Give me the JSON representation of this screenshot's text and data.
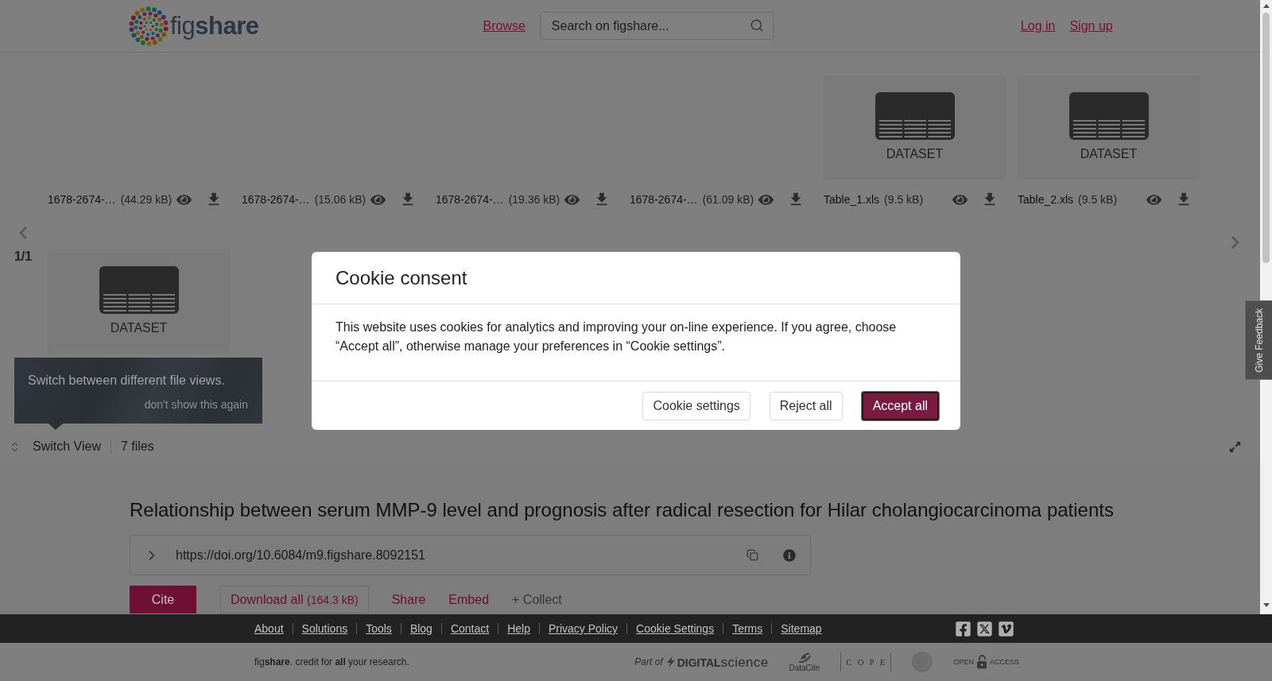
{
  "header": {
    "logo": "fig**share**",
    "nav_links": [
      {
        "label": "Browse"
      }
    ],
    "search": {
      "placeholder": "Search on figshare..."
    },
    "account_links": [
      {
        "label": "Log in"
      },
      {
        "label": "Sign up"
      }
    ]
  },
  "viewer": {
    "files": [
      {
        "name": "1678-2674-…",
        "size": "(44.29 kB)",
        "preview": {
          "kind": "blank"
        }
      },
      {
        "name": "1678-2674-…",
        "size": "(15.06 kB)",
        "preview": {
          "kind": "blank"
        }
      },
      {
        "name": "1678-2674-…",
        "size": "(19.36 kB)",
        "preview": {
          "kind": "blank"
        }
      },
      {
        "name": "1678-2674-…",
        "size": "(61.09 kB)",
        "preview": {
          "kind": "blank"
        }
      },
      {
        "name": "Table_1.xls",
        "size": "(9.5 kB)",
        "preview": {
          "kind": "dataset",
          "label": "DATASET"
        }
      },
      {
        "name": "Table_2.xls",
        "size": "(9.5 kB)",
        "preview": {
          "kind": "dataset",
          "label": "DATASET"
        }
      }
    ],
    "page_counter": "1/1",
    "next_row": [
      {
        "preview": {
          "kind": "dataset",
          "label": "DATASET"
        }
      }
    ],
    "tooltip": {
      "text": "Switch between different file views.",
      "dismiss": "don't show this again"
    },
    "toolbar": {
      "switch_view": "Switch View",
      "file_count": "7 files"
    }
  },
  "article": {
    "title": "Relationship between serum MMP-9 level and prognosis after radical resection for Hilar cholangiocarcinoma patients",
    "doi": "https://doi.org/10.6084/m9.figshare.8092151",
    "actions": [
      {
        "kind": "primary",
        "label": "Cite"
      },
      {
        "kind": "outline",
        "label": "Download all",
        "note": "(164.3 kB)"
      },
      {
        "kind": "link",
        "label": "Share"
      },
      {
        "kind": "link",
        "label": "Embed"
      },
      {
        "kind": "muted",
        "label": "+ Collect"
      }
    ]
  },
  "feedback_tab": {
    "label": "Give Feedback"
  },
  "footer": {
    "links": [
      "About",
      "Solutions",
      "Tools",
      "Blog",
      "Contact",
      "Help",
      "Privacy Policy",
      "Cookie Settings",
      "Terms",
      "Sitemap"
    ],
    "tagline": "fig**share**. credit for **all** your research.",
    "partners": [
      {
        "kind": "science",
        "prefix": "Part of",
        "name": "**DIGITAL**science"
      },
      {
        "kind": "datacite",
        "name": "DataCite"
      },
      {
        "kind": "cope",
        "name": "COPE"
      },
      {
        "kind": "seal"
      },
      {
        "kind": "openaccess",
        "prefix": "OPEN",
        "name": "ACCESS"
      }
    ]
  },
  "cookie_dialog": {
    "title": "Cookie consent",
    "text": "This website uses cookies for analytics and improving your on-line experience. If you agree, choose “Accept all”, otherwise manage your preferences in “Cookie settings”.",
    "buttons": [
      {
        "kind": "secondary",
        "label": "Cookie settings"
      },
      {
        "kind": "secondary",
        "label": "Reject all"
      },
      {
        "kind": "primary",
        "label": "Accept all"
      }
    ]
  }
}
